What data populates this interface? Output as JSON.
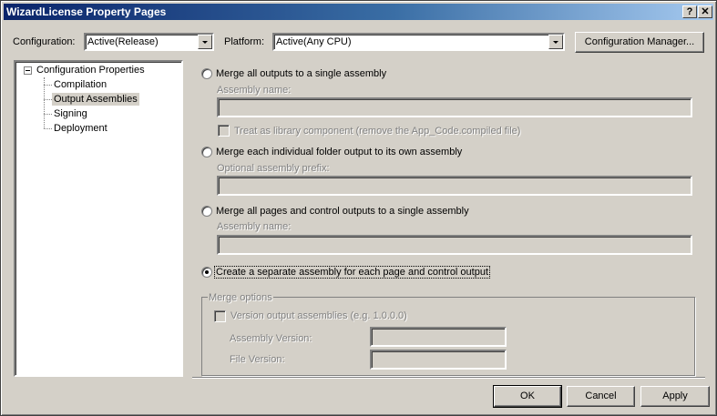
{
  "window": {
    "title": "WizardLicense Property Pages"
  },
  "title_buttons": {
    "help": "?",
    "close": "✕"
  },
  "toolbar": {
    "configuration_label": "Configuration:",
    "configuration_value": "Active(Release)",
    "platform_label": "Platform:",
    "platform_value": "Active(Any CPU)",
    "config_manager_label": "Configuration Manager..."
  },
  "tree": {
    "root": "Configuration Properties",
    "items": [
      "Compilation",
      "Output Assemblies",
      "Signing",
      "Deployment"
    ],
    "selected": "Output Assemblies"
  },
  "options": {
    "merge_all_label": "Merge all outputs to a single assembly",
    "merge_all_name_label": "Assembly name:",
    "merge_all_name_value": "",
    "library_component_label": "Treat as library component (remove the App_Code.compiled file)",
    "merge_each_label": "Merge each individual folder output to its own assembly",
    "prefix_label": "Optional assembly prefix:",
    "prefix_value": "",
    "merge_pages_label": "Merge all pages and control outputs to a single assembly",
    "merge_pages_name_label": "Assembly name:",
    "merge_pages_name_value": "",
    "separate_label": "Create a separate assembly for each page and control output",
    "selected_option": "separate"
  },
  "merge_options": {
    "group_label": "Merge options",
    "version_output_label": "Version output assemblies (e.g. 1.0.0.0)",
    "assembly_version_label": "Assembly Version:",
    "assembly_version_value": "",
    "file_version_label": "File Version:",
    "file_version_value": ""
  },
  "footer": {
    "ok": "OK",
    "cancel": "Cancel",
    "apply": "Apply"
  }
}
